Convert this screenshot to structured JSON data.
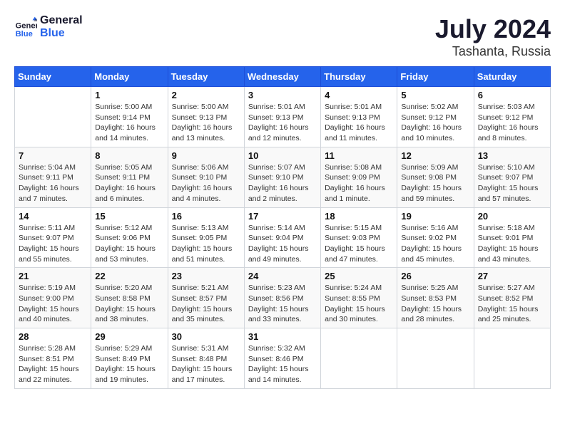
{
  "logo": {
    "text_general": "General",
    "text_blue": "Blue"
  },
  "title": "July 2024",
  "subtitle": "Tashanta, Russia",
  "weekdays": [
    "Sunday",
    "Monday",
    "Tuesday",
    "Wednesday",
    "Thursday",
    "Friday",
    "Saturday"
  ],
  "weeks": [
    [
      {
        "day": null
      },
      {
        "day": 1,
        "sunrise": "5:00 AM",
        "sunset": "9:14 PM",
        "daylight": "16 hours and 14 minutes."
      },
      {
        "day": 2,
        "sunrise": "5:00 AM",
        "sunset": "9:13 PM",
        "daylight": "16 hours and 13 minutes."
      },
      {
        "day": 3,
        "sunrise": "5:01 AM",
        "sunset": "9:13 PM",
        "daylight": "16 hours and 12 minutes."
      },
      {
        "day": 4,
        "sunrise": "5:01 AM",
        "sunset": "9:13 PM",
        "daylight": "16 hours and 11 minutes."
      },
      {
        "day": 5,
        "sunrise": "5:02 AM",
        "sunset": "9:12 PM",
        "daylight": "16 hours and 10 minutes."
      },
      {
        "day": 6,
        "sunrise": "5:03 AM",
        "sunset": "9:12 PM",
        "daylight": "16 hours and 8 minutes."
      }
    ],
    [
      {
        "day": 7,
        "sunrise": "5:04 AM",
        "sunset": "9:11 PM",
        "daylight": "16 hours and 7 minutes."
      },
      {
        "day": 8,
        "sunrise": "5:05 AM",
        "sunset": "9:11 PM",
        "daylight": "16 hours and 6 minutes."
      },
      {
        "day": 9,
        "sunrise": "5:06 AM",
        "sunset": "9:10 PM",
        "daylight": "16 hours and 4 minutes."
      },
      {
        "day": 10,
        "sunrise": "5:07 AM",
        "sunset": "9:10 PM",
        "daylight": "16 hours and 2 minutes."
      },
      {
        "day": 11,
        "sunrise": "5:08 AM",
        "sunset": "9:09 PM",
        "daylight": "16 hours and 1 minute."
      },
      {
        "day": 12,
        "sunrise": "5:09 AM",
        "sunset": "9:08 PM",
        "daylight": "15 hours and 59 minutes."
      },
      {
        "day": 13,
        "sunrise": "5:10 AM",
        "sunset": "9:07 PM",
        "daylight": "15 hours and 57 minutes."
      }
    ],
    [
      {
        "day": 14,
        "sunrise": "5:11 AM",
        "sunset": "9:07 PM",
        "daylight": "15 hours and 55 minutes."
      },
      {
        "day": 15,
        "sunrise": "5:12 AM",
        "sunset": "9:06 PM",
        "daylight": "15 hours and 53 minutes."
      },
      {
        "day": 16,
        "sunrise": "5:13 AM",
        "sunset": "9:05 PM",
        "daylight": "15 hours and 51 minutes."
      },
      {
        "day": 17,
        "sunrise": "5:14 AM",
        "sunset": "9:04 PM",
        "daylight": "15 hours and 49 minutes."
      },
      {
        "day": 18,
        "sunrise": "5:15 AM",
        "sunset": "9:03 PM",
        "daylight": "15 hours and 47 minutes."
      },
      {
        "day": 19,
        "sunrise": "5:16 AM",
        "sunset": "9:02 PM",
        "daylight": "15 hours and 45 minutes."
      },
      {
        "day": 20,
        "sunrise": "5:18 AM",
        "sunset": "9:01 PM",
        "daylight": "15 hours and 43 minutes."
      }
    ],
    [
      {
        "day": 21,
        "sunrise": "5:19 AM",
        "sunset": "9:00 PM",
        "daylight": "15 hours and 40 minutes."
      },
      {
        "day": 22,
        "sunrise": "5:20 AM",
        "sunset": "8:58 PM",
        "daylight": "15 hours and 38 minutes."
      },
      {
        "day": 23,
        "sunrise": "5:21 AM",
        "sunset": "8:57 PM",
        "daylight": "15 hours and 35 minutes."
      },
      {
        "day": 24,
        "sunrise": "5:23 AM",
        "sunset": "8:56 PM",
        "daylight": "15 hours and 33 minutes."
      },
      {
        "day": 25,
        "sunrise": "5:24 AM",
        "sunset": "8:55 PM",
        "daylight": "15 hours and 30 minutes."
      },
      {
        "day": 26,
        "sunrise": "5:25 AM",
        "sunset": "8:53 PM",
        "daylight": "15 hours and 28 minutes."
      },
      {
        "day": 27,
        "sunrise": "5:27 AM",
        "sunset": "8:52 PM",
        "daylight": "15 hours and 25 minutes."
      }
    ],
    [
      {
        "day": 28,
        "sunrise": "5:28 AM",
        "sunset": "8:51 PM",
        "daylight": "15 hours and 22 minutes."
      },
      {
        "day": 29,
        "sunrise": "5:29 AM",
        "sunset": "8:49 PM",
        "daylight": "15 hours and 19 minutes."
      },
      {
        "day": 30,
        "sunrise": "5:31 AM",
        "sunset": "8:48 PM",
        "daylight": "15 hours and 17 minutes."
      },
      {
        "day": 31,
        "sunrise": "5:32 AM",
        "sunset": "8:46 PM",
        "daylight": "15 hours and 14 minutes."
      },
      {
        "day": null
      },
      {
        "day": null
      },
      {
        "day": null
      }
    ]
  ]
}
